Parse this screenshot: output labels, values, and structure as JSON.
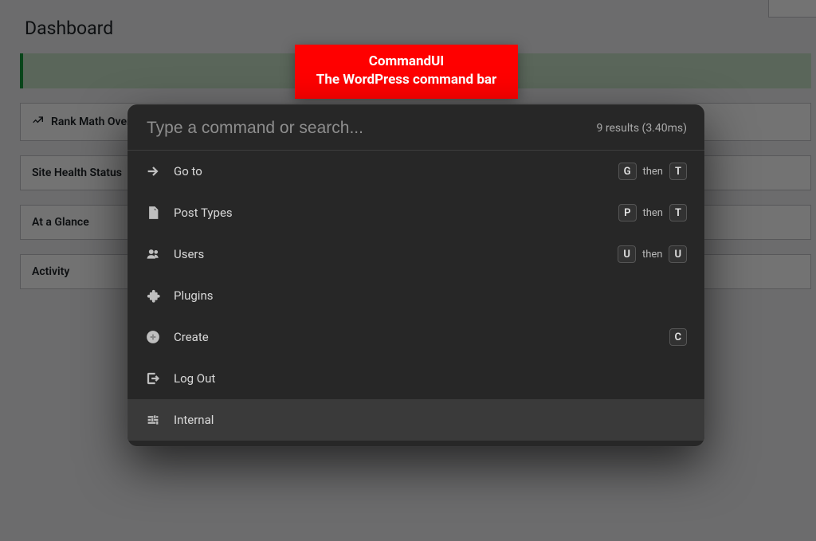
{
  "dashboard": {
    "title": "Dashboard",
    "metaboxes": [
      {
        "label": "Rank Math Overview",
        "icon": "chart-icon"
      },
      {
        "label": "Site Health Status",
        "icon": null
      },
      {
        "label": "At a Glance",
        "icon": null
      },
      {
        "label": "Activity",
        "icon": null
      }
    ]
  },
  "banner": {
    "line1": "CommandUI",
    "line2": "The WordPress command bar"
  },
  "palette": {
    "placeholder": "Type a command or search...",
    "results_text": "9 results (3.40ms)",
    "shortcut_joiner": "then",
    "items": [
      {
        "icon": "arrow-right-icon",
        "label": "Go to",
        "keys": [
          "G",
          "T"
        ],
        "hover": false
      },
      {
        "icon": "page-icon",
        "label": "Post Types",
        "keys": [
          "P",
          "T"
        ],
        "hover": false
      },
      {
        "icon": "users-icon",
        "label": "Users",
        "keys": [
          "U",
          "U"
        ],
        "hover": false
      },
      {
        "icon": "puzzle-icon",
        "label": "Plugins",
        "keys": null,
        "hover": false
      },
      {
        "icon": "plus-circle-icon",
        "label": "Create",
        "keys": [
          "C"
        ],
        "hover": false
      },
      {
        "icon": "logout-icon",
        "label": "Log Out",
        "keys": null,
        "hover": false
      },
      {
        "icon": "sliders-icon",
        "label": "Internal",
        "keys": null,
        "hover": true
      }
    ]
  }
}
